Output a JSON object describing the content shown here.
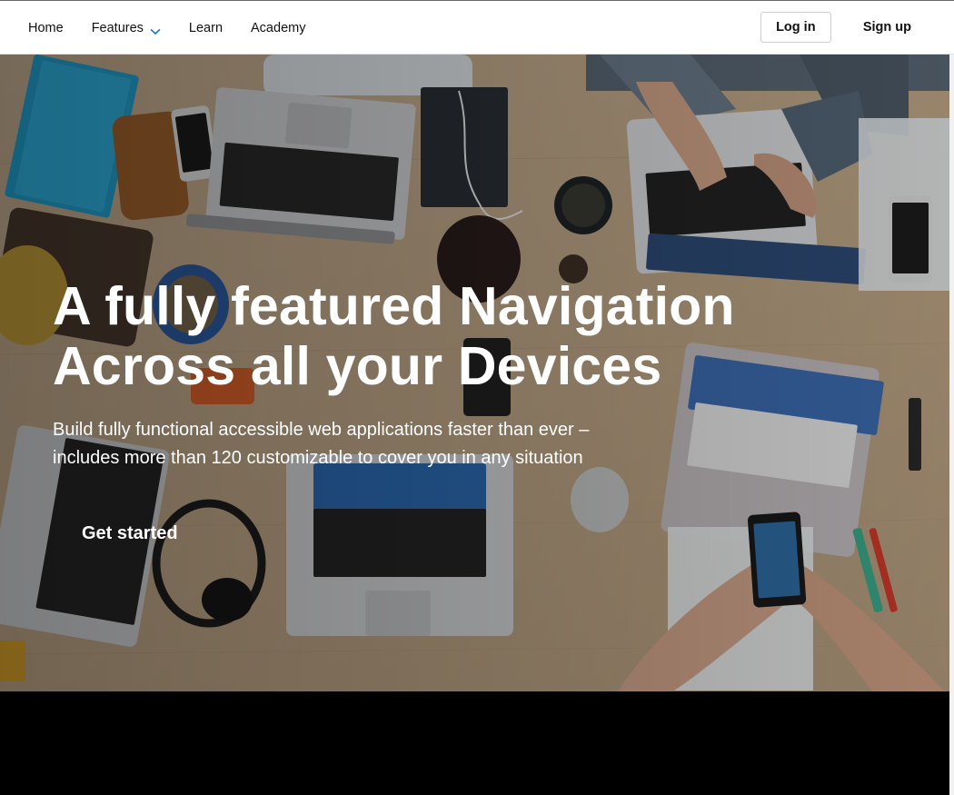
{
  "nav": {
    "links": [
      {
        "label": "Home"
      },
      {
        "label": "Features"
      },
      {
        "label": "Learn"
      },
      {
        "label": "Academy"
      }
    ],
    "login_label": "Log in",
    "signup_label": "Sign up"
  },
  "hero": {
    "title_line1": "A fully featured Navigation",
    "title_line2": "Across all your Devices",
    "subtitle_line1": "Build fully functional accessible web applications faster than ever –",
    "subtitle_line2": "includes more than 120 customizable to cover you in any situation",
    "cta_label": "Get started"
  },
  "colors": {
    "nav_bg": "#ffffff",
    "hero_text": "#ffffff",
    "accent": "#1a73c8",
    "page_bg": "#000000"
  },
  "icons": {
    "features_dropdown": "chevron-down-icon"
  }
}
